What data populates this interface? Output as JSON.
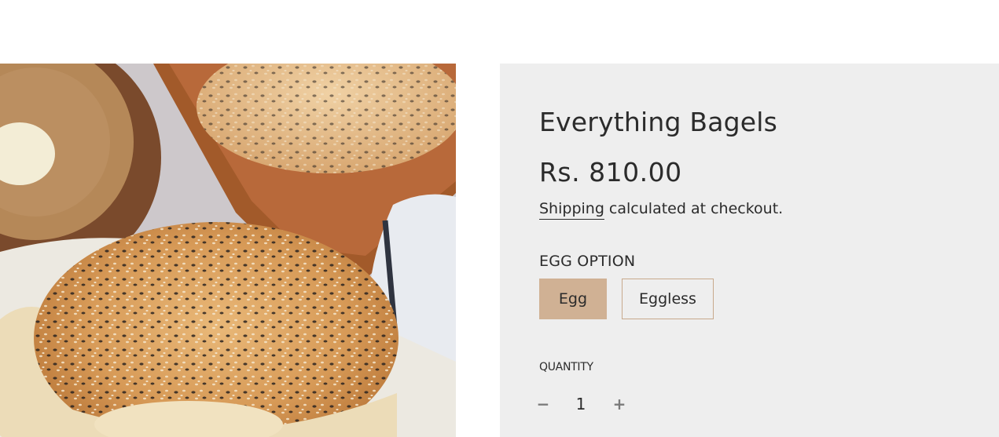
{
  "product": {
    "image_alt": "",
    "title": "Everything Bagels",
    "price": "Rs. 810.00",
    "shipping_link": "Shipping",
    "shipping_note": " calculated at checkout."
  },
  "options": {
    "label": "EGG OPTION",
    "values": [
      "Egg",
      "Eggless"
    ],
    "selected": "Egg"
  },
  "quantity": {
    "label": "QUANTITY",
    "value": "1",
    "minus_icon": "minus-icon",
    "plus_icon": "plus-icon"
  },
  "colors": {
    "panel_bg": "#eeeeee",
    "selected_option_bg": "#d0b194",
    "option_border": "#c8a98c",
    "text": "#2b2b2b"
  }
}
